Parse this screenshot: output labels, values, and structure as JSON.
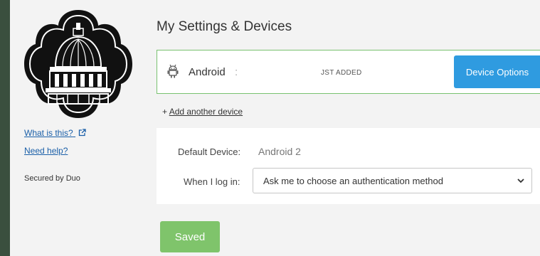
{
  "sidebar": {
    "what_is_this": "What is this?",
    "need_help": "Need help?",
    "secured_by": "Secured by Duo"
  },
  "main": {
    "title": "My Settings & Devices",
    "device": {
      "name": "Android",
      "name_extra": ":",
      "status": "JST ADDED",
      "options_label": "Device Options"
    },
    "add_device_prefix": "+ ",
    "add_device_label": "Add another device",
    "settings": {
      "default_device_label": "Default Device:",
      "default_device_value": "Android 2",
      "login_label": "When I log in:",
      "login_option": "Ask me to choose an authentication method"
    },
    "saved_label": "Saved"
  },
  "colors": {
    "brand_green": "#7fc46b",
    "card_border": "#79c270",
    "primary_blue": "#2f9be0",
    "background_dark": "#3a4f3e"
  },
  "icons": {
    "logo": "building-dome-logo",
    "device": "android-icon",
    "external_link": "external-link-icon",
    "select": "chevron-down-icon"
  }
}
